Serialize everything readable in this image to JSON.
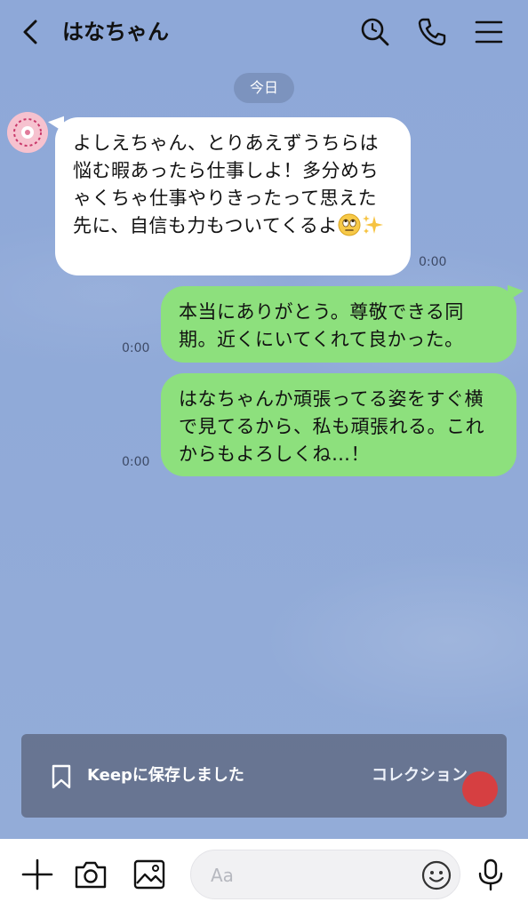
{
  "header": {
    "title": "はなちゃん",
    "icons": [
      "back-arrow-icon",
      "search-icon",
      "phone-icon",
      "menu-icon"
    ]
  },
  "date_label": "今日",
  "messages": [
    {
      "side": "in",
      "text": "よしえちゃん、とりあえずうちらは悩む暇あったら仕事しよ！多分めちゃくちゃ仕事やりきったって思えた先に、自信も力もついてくるよ",
      "emojis": [
        "face-with-rolling-eyes",
        "sparkles"
      ],
      "time": "0:00"
    },
    {
      "side": "out",
      "text": "本当にありがとう。尊敬できる同期。近くにいてくれて良かった。",
      "time": "0:00"
    },
    {
      "side": "out",
      "text": "はなちゃんか頑張ってる姿をすぐ横で見てるから、私も頑張れる。これからもよろしくね…！",
      "time": "0:00"
    }
  ],
  "toast": {
    "message": "Keepに保存しました",
    "link": "コレクション"
  },
  "input_bar": {
    "placeholder": "Aa",
    "icons": [
      "plus-icon",
      "camera-icon",
      "image-icon",
      "emoji-icon",
      "mic-icon"
    ]
  },
  "colors": {
    "background": "#8fa8d6",
    "outgoing_bubble": "#8de07d",
    "incoming_bubble": "#ffffff",
    "touch_indicator": "#e03b3b"
  }
}
